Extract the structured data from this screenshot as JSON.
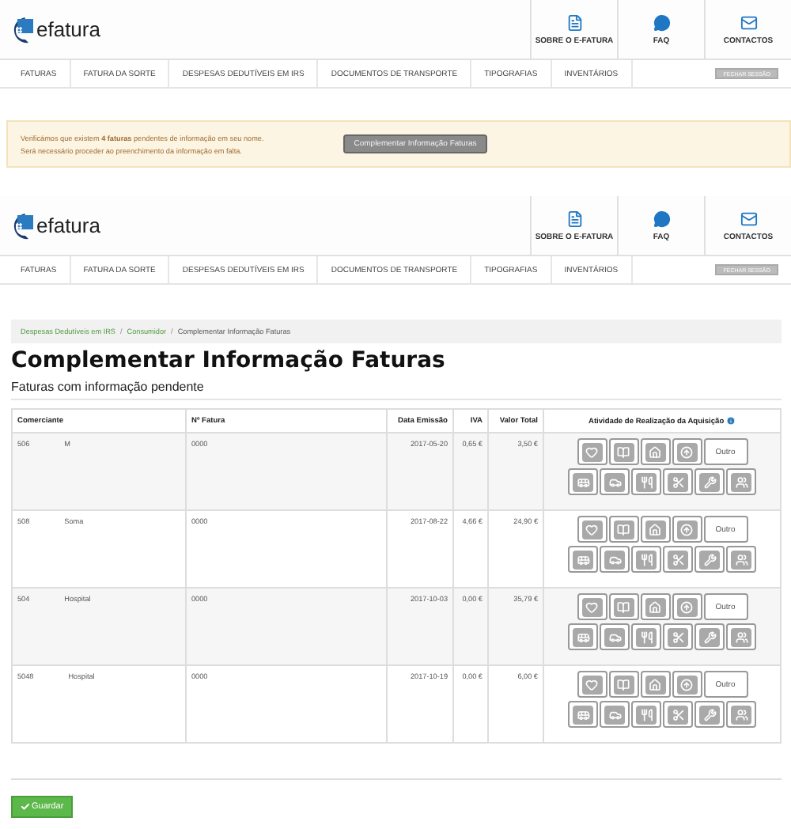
{
  "headers": [
    {
      "logo": "efatura",
      "links": [
        "SOBRE O E-FATURA",
        "FAQ",
        "CONTACTOS"
      ],
      "nav": [
        "FATURAS",
        "FATURA DA SORTE",
        "DESPESAS DEDUTÍVEIS EM IRS",
        "DOCUMENTOS DE TRANSPORTE",
        "TIPOGRAFIAS",
        "INVENTÁRIOS"
      ],
      "logout": "FECHAR SESSÃO"
    },
    {
      "logo": "efatura",
      "links": [
        "SOBRE O E-FATURA",
        "FAQ",
        "CONTACTOS"
      ],
      "nav": [
        "FATURAS",
        "FATURA DA SORTE",
        "DESPESAS DEDUTÍVEIS EM IRS",
        "DOCUMENTOS DE TRANSPORTE",
        "TIPOGRAFIAS",
        "INVENTÁRIOS"
      ],
      "logout": "FECHAR SESSÃO"
    }
  ],
  "notice": {
    "lines": [
      "Verificámos que existem **4 faturas** pendentes de informação em seu nome.",
      "Será necessário proceder ao preenchimento da informação em falta."
    ],
    "button": "Complementar Informação Faturas"
  },
  "breadcrumb_separator": "/",
  "breadcrumb": [
    {
      "label": "Despesas Dedutíveis em IRS",
      "link": true
    },
    {
      "label": "Consumidor",
      "link": true
    },
    {
      "label": "Complementar Informação Faturas",
      "link": false
    }
  ],
  "title": "Complementar Informação Faturas",
  "subtitle": "Faturas com informação pendente",
  "table": {
    "columns": [
      "Comerciante",
      "Nº Fatura",
      "Data Emissão",
      "IVA",
      "Valor Total",
      "Atividade de Realização da Aquisição"
    ],
    "rows": [
      {
        "nif": "506",
        "name": "M",
        "invoice": "0000",
        "date": "2017-05-20",
        "iva": "0,65 €",
        "total": "3,50 €",
        "other": "Outro"
      },
      {
        "nif": "508",
        "name": "Soma",
        "invoice": "0000",
        "date": "2017-08-22",
        "iva": "4,66 €",
        "total": "24,90 €",
        "other": "Outro"
      },
      {
        "nif": "504",
        "name": "Hospital",
        "invoice": "0000",
        "date": "2017-10-03",
        "iva": "0,00 €",
        "total": "35,79 €",
        "other": "Outro"
      },
      {
        "nif": "5048",
        "name": "Hospital",
        "invoice": "0000",
        "date": "2017-10-19",
        "iva": "0,00 €",
        "total": "6,00 €",
        "other": "Outro"
      }
    ]
  },
  "save_button": "Guardar"
}
